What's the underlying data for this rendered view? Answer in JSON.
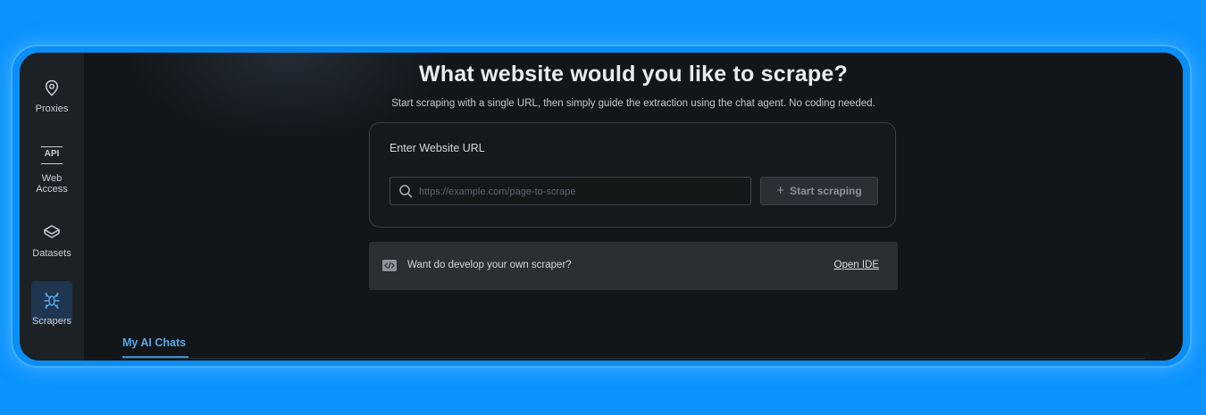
{
  "sidebar": {
    "items": [
      {
        "label": "Proxies",
        "icon": "location-pin-icon",
        "active": false
      },
      {
        "label": "Web Access",
        "icon": "api-icon",
        "icon_text": "API",
        "active": false
      },
      {
        "label": "Datasets",
        "icon": "layers-icon",
        "active": false
      },
      {
        "label": "Scrapers",
        "icon": "spider-icon",
        "active": true
      }
    ]
  },
  "main": {
    "title": "What website would you like to scrape?",
    "subtitle": "Start scraping with a single URL, then simply guide the extraction using the chat agent. No coding needed.",
    "url_card": {
      "label": "Enter Website URL",
      "placeholder": "https://example.com/page-to-scrape",
      "value": "",
      "button_label": "Start scraping",
      "button_icon": "plus-icon"
    },
    "ide_bar": {
      "icon": "code-icon",
      "text": "Want do develop your own scraper?",
      "link": "Open IDE"
    },
    "tabs": [
      {
        "label": "My AI Chats",
        "active": true
      }
    ]
  },
  "colors": {
    "page_background": "#0b93ff",
    "window_background": "#121619",
    "sidebar_background": "#1c2125",
    "accent": "#5aa7e6",
    "active_nav_background": "#1f3550"
  }
}
